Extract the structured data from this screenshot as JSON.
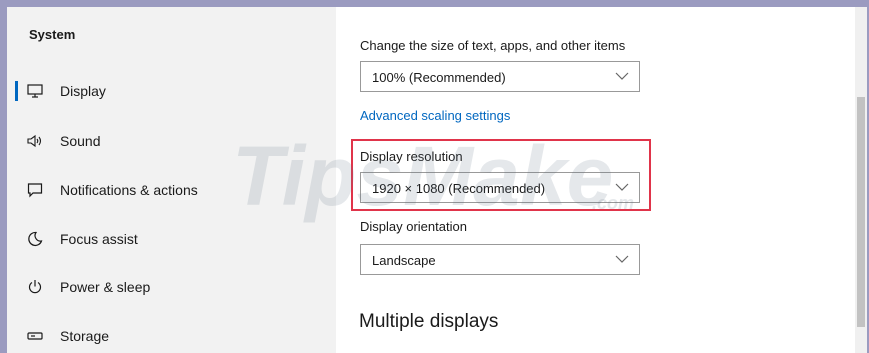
{
  "sidebar": {
    "title": "System",
    "items": [
      {
        "label": "Display",
        "icon": "monitor-icon",
        "selected": true
      },
      {
        "label": "Sound",
        "icon": "speaker-icon"
      },
      {
        "label": "Notifications & actions",
        "icon": "notification-icon"
      },
      {
        "label": "Focus assist",
        "icon": "moon-icon"
      },
      {
        "label": "Power & sleep",
        "icon": "power-icon"
      },
      {
        "label": "Storage",
        "icon": "storage-icon"
      }
    ]
  },
  "main": {
    "scale_label": "Change the size of text, apps, and other items",
    "scale_value": "100% (Recommended)",
    "advanced_link": "Advanced scaling settings",
    "resolution_label": "Display resolution",
    "resolution_value": "1920 × 1080 (Recommended)",
    "orientation_label": "Display orientation",
    "orientation_value": "Landscape",
    "multiple_displays_title": "Multiple displays"
  },
  "watermark": {
    "text": "TipsMake",
    "suffix": ".com"
  },
  "colors": {
    "accent": "#0067c0",
    "highlight_border": "#e0344a",
    "sidebar_bg": "#f2f2f2",
    "outer_bg": "#9b9bc0"
  }
}
